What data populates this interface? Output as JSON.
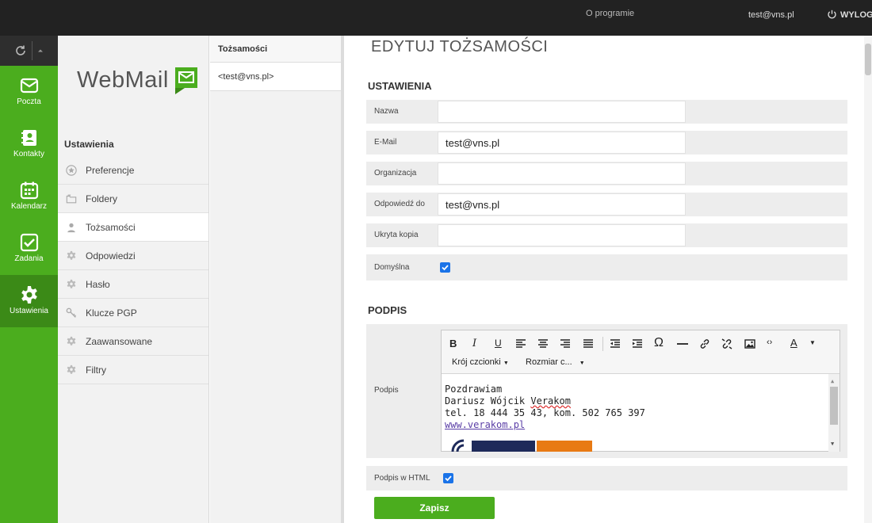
{
  "topbar": {
    "about": "O programie",
    "user": "test@vns.pl",
    "logout": "WYLOG"
  },
  "nav": {
    "mail": "Poczta",
    "contacts": "Kontakty",
    "calendar": "Kalendarz",
    "tasks": "Zadania",
    "settings": "Ustawienia"
  },
  "logo": {
    "text": "WebMail"
  },
  "settings": {
    "heading": "Ustawienia",
    "items": [
      "Preferencje",
      "Foldery",
      "Tożsamości",
      "Odpowiedzi",
      "Hasło",
      "Klucze PGP",
      "Zaawansowane",
      "Filtry"
    ]
  },
  "identities": {
    "header": "Tożsamości",
    "items": [
      "<test@vns.pl>"
    ]
  },
  "main": {
    "title": "EDYTUJ TOŻSAMOŚCI",
    "section_settings": "USTAWIENIA",
    "fields": {
      "name": {
        "label": "Nazwa",
        "value": ""
      },
      "email": {
        "label": "E-Mail",
        "value": "test@vns.pl"
      },
      "organization": {
        "label": "Organizacja",
        "value": ""
      },
      "reply_to": {
        "label": "Odpowiedź do",
        "value": "test@vns.pl"
      },
      "bcc": {
        "label": "Ukryta kopia",
        "value": ""
      },
      "default": {
        "label": "Domyślna",
        "checked": true
      }
    },
    "section_signature": "PODPIS",
    "signature": {
      "label": "Podpis",
      "font_select": "Krój czcionki",
      "size_select": "Rozmiar c...",
      "lines": [
        "Pozdrawiam",
        "Dariusz Wójcik ",
        "Verakom",
        "tel. 18 444 35 43, kom. 502 765 397",
        "www.verakom.pl"
      ]
    },
    "html_signature": {
      "label": "Podpis w HTML",
      "checked": true
    },
    "save": "Zapisz"
  },
  "colors": {
    "brand_green": "#4bad1e",
    "active_green": "#3b8a17",
    "topbar": "#222222",
    "checkbox": "#1a73e8"
  }
}
